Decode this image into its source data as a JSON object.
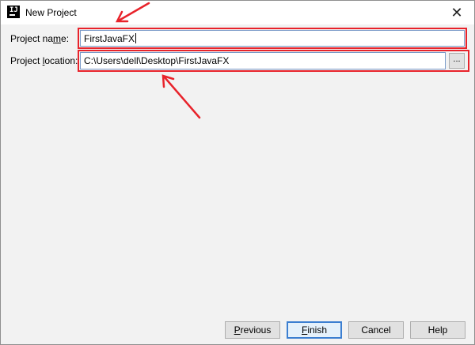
{
  "window": {
    "title": "New Project",
    "app_icon_text": "IJ",
    "close_glyph": "✕"
  },
  "form": {
    "name_label_pre": "Project na",
    "name_label_mnemonic": "m",
    "name_label_post": "e:",
    "name_value": "FirstJavaFX",
    "location_label_pre": "Project ",
    "location_label_mnemonic": "l",
    "location_label_post": "ocation:",
    "location_value": "C:\\Users\\dell\\Desktop\\FirstJavaFX",
    "browse_label": "..."
  },
  "buttons": {
    "previous_mnemonic": "P",
    "previous_rest": "revious",
    "finish_mnemonic": "F",
    "finish_rest": "inish",
    "cancel": "Cancel",
    "help": "Help"
  },
  "annotations": {
    "highlight_color": "#e8232b",
    "arrow_color": "#e8232b"
  }
}
